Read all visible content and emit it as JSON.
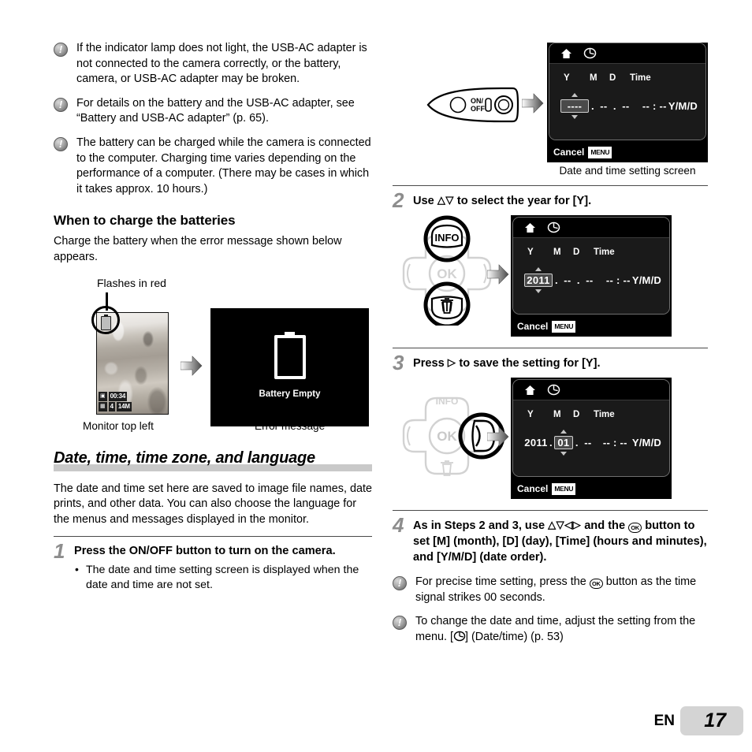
{
  "left_column": {
    "notes_top": [
      "If the indicator lamp does not light, the USB-AC adapter is not connected to the camera correctly, or the battery, camera, or USB-AC adapter may be broken.",
      "For details on the battery and the USB-AC adapter, see “Battery and USB-AC adapter” (p. 65).",
      "The battery can be charged while the camera is connected to the computer. Charging time varies depending on the performance of a computer. (There may be cases in which it takes approx. 10 hours.)"
    ],
    "subheading": "When to charge the batteries",
    "intro": "Charge the battery when the error message shown below appears.",
    "illustration": {
      "callout": "Flashes in red",
      "monitor_osd": {
        "time": "00:34",
        "count": "4",
        "size": "14M"
      },
      "error_screen_label": "Battery Empty",
      "caption_left": "Monitor top left",
      "caption_right": "Error message"
    },
    "chapter_heading": "Date, time, time zone, and language",
    "chapter_intro": "The date and time set here are saved to image file names, date prints, and other data. You can also choose the language for the menus and messages displayed in the monitor.",
    "step1": {
      "number": "1",
      "title_pre": "Press the ",
      "title_btn": "ON/OFF",
      "title_post": " button to turn on the camera.",
      "bullets": [
        "The date and time setting screen is displayed when the date and time are not set."
      ]
    }
  },
  "right_column": {
    "screen_common": {
      "header_y": "Y",
      "header_m": "M",
      "header_d": "D",
      "header_time": "Time",
      "order": "Y/M/D",
      "cancel": "Cancel",
      "menu_chip": "MENU",
      "time_dashes": "-- : --"
    },
    "step1_screen": {
      "year": "----",
      "month": "--",
      "day": "--",
      "caption": "Date and time setting screen"
    },
    "step2": {
      "number": "2",
      "title_pre": "Use ",
      "title_glyphs": "△▽",
      "title_post": " to select the year for [Y].",
      "screen": {
        "year": "2011",
        "month": "--",
        "day": "--"
      },
      "buttons": {
        "up_label": "INFO",
        "center_label": "OK",
        "down_label": "trash-icon"
      }
    },
    "step3": {
      "number": "3",
      "title_pre": "Press ",
      "title_glyphs": "▷",
      "title_post": " to save the setting for [Y].",
      "screen": {
        "year": "2011",
        "month": "01",
        "day": "--"
      },
      "buttons": {
        "up_label": "INFO",
        "center_label": "OK",
        "right_label": "right-arrow"
      }
    },
    "step4": {
      "number": "4",
      "line1_pre": "As in Steps 2 and 3, use ",
      "line1_glyphs": "△▽◁▷",
      "line1_post": " and the",
      "line2_btn": "OK",
      "line2_post": " button to set [M] (month), [D] (day), [Time] (hours and minutes), and [Y/M/D] (date order).",
      "notes": [
        {
          "pre": "For precise time setting, press the ",
          "btn": "OK",
          "post": " button as the time signal strikes 00 seconds."
        },
        {
          "pre": "To change the date and time, adjust the setting from the menu. [",
          "icon": "clock-icon",
          "post": "] (Date/time) (p. 53)"
        }
      ]
    }
  },
  "footer": {
    "language_code": "EN",
    "page_number": "17"
  },
  "colors": {
    "page_bg": "#ffffff",
    "text": "#000000",
    "step_number": "#8d8d8d",
    "heading_bar": "#c9c9c9",
    "rule": "#4a4a4a",
    "screen_bg": "#000000",
    "footer_box": "#d4d4d4"
  }
}
